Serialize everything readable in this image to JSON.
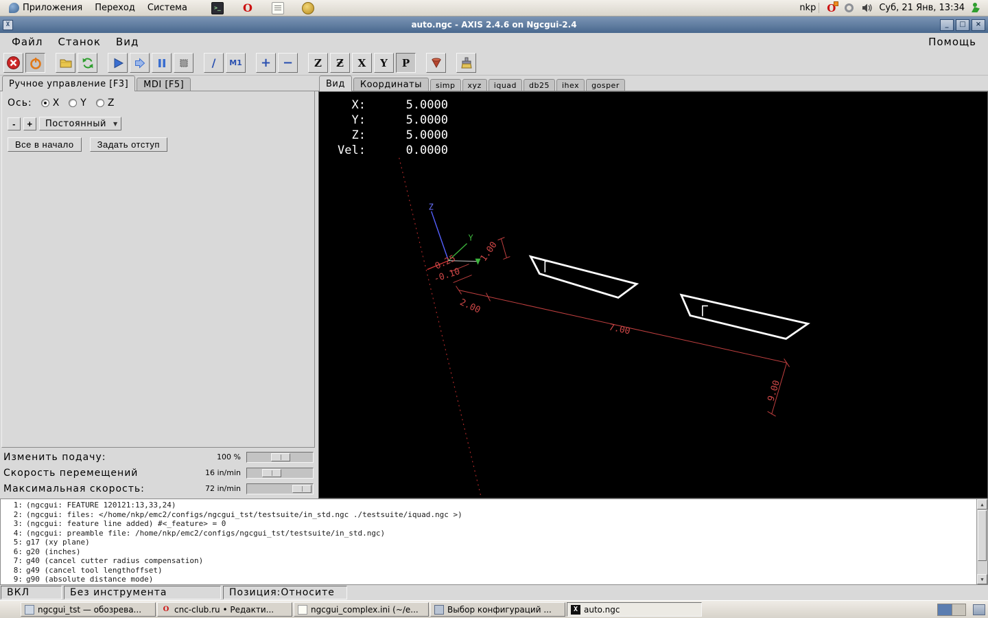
{
  "desktop_panel": {
    "menus": [
      {
        "label": "Приложения"
      },
      {
        "label": "Переход"
      },
      {
        "label": "Система"
      }
    ],
    "username": "nkp",
    "clock": "Суб, 21 Янв, 13:34"
  },
  "titlebar": {
    "title": "auto.ngc - AXIS 2.4.6 on Ngcgui-2.4",
    "controls": {
      "minimize": "_",
      "maximize": "□",
      "close": "×"
    }
  },
  "menubar": {
    "items": [
      {
        "label": "Файл"
      },
      {
        "label": "Станок"
      },
      {
        "label": "Вид"
      }
    ],
    "help": "Помощь"
  },
  "toolbar": {
    "slash": "/",
    "m1": "M1",
    "zoom_in": "+",
    "zoom_out": "−",
    "letters": {
      "z": "Z",
      "z2": "Ƶ",
      "x": "X",
      "y": "Y",
      "p": "P"
    }
  },
  "left_panel": {
    "tab_manual": "Ручное управление [F3]",
    "tab_mdi": "MDI [F5]",
    "axis_label": "Ось:",
    "axis_options": [
      {
        "label": "X"
      },
      {
        "label": "Y"
      },
      {
        "label": "Z"
      }
    ],
    "jog_minus": "-",
    "jog_plus": "+",
    "jog_mode": "Постоянный",
    "home_all": "Все в начало",
    "touch_off": "Задать отступ",
    "sliders": [
      {
        "label": "Изменить подачу:",
        "value": "100 %",
        "pos": 52
      },
      {
        "label": "Скорость перемещений",
        "value": "16 in/min",
        "pos": 33
      },
      {
        "label": "Максимальная скорость:",
        "value": "72 in/min",
        "pos": 97
      }
    ]
  },
  "preview": {
    "tab_view": "Вид",
    "tab_coords": "Координаты",
    "sub_tabs": [
      {
        "label": "simp"
      },
      {
        "label": "xyz"
      },
      {
        "label": "iquad"
      },
      {
        "label": "db25"
      },
      {
        "label": "ihex"
      },
      {
        "label": "gosper"
      }
    ],
    "dro": [
      {
        "label": "X:",
        "value": "5.0000"
      },
      {
        "label": "Y:",
        "value": "5.0000"
      },
      {
        "label": "Z:",
        "value": "5.0000"
      },
      {
        "label": "Vel:",
        "value": "0.0000"
      }
    ],
    "dims": [
      {
        "text": "1.00"
      },
      {
        "text": "0.25"
      },
      {
        "text": "-0.10"
      },
      {
        "text": "2.00"
      },
      {
        "text": "7.00"
      },
      {
        "text": "9.00"
      }
    ],
    "axis_letters": {
      "z": "Z",
      "y": "Y"
    }
  },
  "gcode": {
    "lines": [
      {
        "num": "1:",
        "text": "(ngcgui: FEATURE 120121:13,33,24)"
      },
      {
        "num": "2:",
        "text": "(ngcgui: files: </home/nkp/emc2/configs/ngcgui_tst/testsuite/in_std.ngc ./testsuite/iquad.ngc >)"
      },
      {
        "num": "3:",
        "text": "(ngcgui: feature line added) #<_feature> = 0"
      },
      {
        "num": "4:",
        "text": "(ngcgui: preamble file: /home/nkp/emc2/configs/ngcgui_tst/testsuite/in_std.ngc)"
      },
      {
        "num": "5:",
        "text": "g17 (xy plane)"
      },
      {
        "num": "6:",
        "text": "g20 (inches)"
      },
      {
        "num": "7:",
        "text": "g40 (cancel cutter radius compensation)"
      },
      {
        "num": "8:",
        "text": "g49 (cancel tool lengthoffset)"
      },
      {
        "num": "9:",
        "text": "g90 (absolute distance mode)"
      }
    ]
  },
  "statusbar": {
    "power": "ВКЛ",
    "tool": "Без инструмента",
    "position": "Позиция:Относите"
  },
  "taskbar": {
    "items": [
      {
        "label": "ngcgui_tst — обозрева..."
      },
      {
        "label": "cnc-club.ru • Редакти..."
      },
      {
        "label": "ngcgui_complex.ini (~/e..."
      },
      {
        "label": "Выбор конфигураций ..."
      },
      {
        "label": "auto.ngc"
      }
    ]
  }
}
